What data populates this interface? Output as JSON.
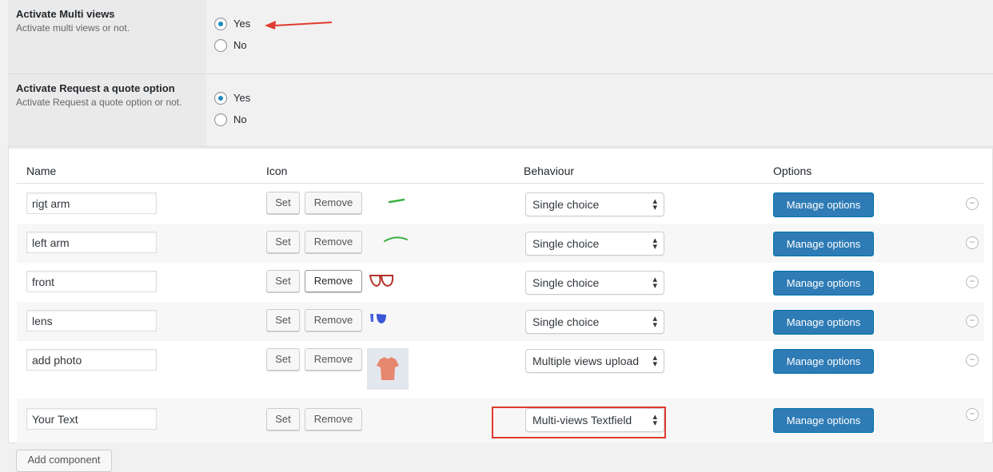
{
  "settings": [
    {
      "title": "Activate Multi views",
      "desc": "Activate multi views or not.",
      "options": [
        "Yes",
        "No"
      ],
      "selected": "Yes"
    },
    {
      "title": "Activate Request a quote option",
      "desc": "Activate Request a quote option or not.",
      "options": [
        "Yes",
        "No"
      ],
      "selected": "Yes"
    }
  ],
  "table": {
    "headers": {
      "name": "Name",
      "icon": "Icon",
      "behaviour": "Behaviour",
      "options": "Options"
    },
    "rows": [
      {
        "name": "rigt arm",
        "icon": "green-arm-stroke-icon",
        "behaviour": "Single choice"
      },
      {
        "name": "left arm",
        "icon": "green-arc-icon",
        "behaviour": "Single choice"
      },
      {
        "name": "front",
        "icon": "glasses-frame-icon",
        "behaviour": "Single choice"
      },
      {
        "name": "lens",
        "icon": "blue-lens-icon",
        "behaviour": "Single choice"
      },
      {
        "name": "add photo",
        "icon": "tshirt-icon",
        "behaviour": "Multiple views upload"
      },
      {
        "name": "Your Text",
        "icon": "",
        "behaviour": "Multi-views Textfield"
      }
    ],
    "set_label": "Set",
    "remove_label": "Remove",
    "manage_label": "Manage options"
  },
  "add_component_label": "Add component",
  "colors": {
    "primary": "#2e7bb5",
    "annotation": "#e03a2f",
    "radio": "#1e8cbe"
  }
}
